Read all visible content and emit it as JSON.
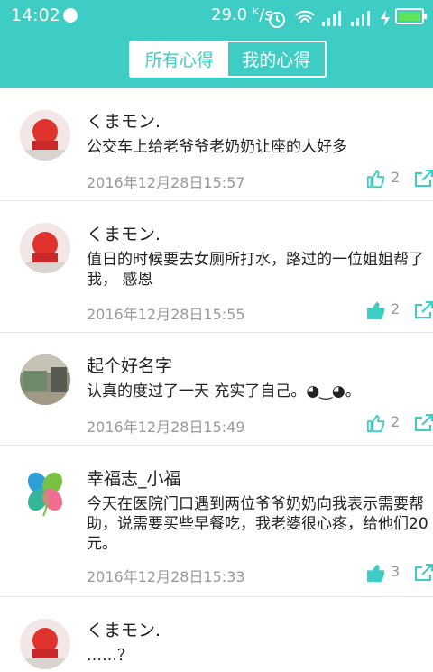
{
  "status_bar": {
    "time": "14:02",
    "speed": "29.0 ᴷ/s"
  },
  "tabs": [
    {
      "label": "所有心得",
      "active": true
    },
    {
      "label": "我的心得",
      "active": false
    }
  ],
  "posts": [
    {
      "name": "くまモン.",
      "content": "公交车上给老爷爷老奶奶让座的人好多",
      "time": "2016年12月28日15:57",
      "likes": "2",
      "liked": false,
      "avatar": "red-bear"
    },
    {
      "name": "くまモン.",
      "content": "值日的时候要去女厕所打水，路过的一位姐姐帮了我，  感恩",
      "time": "2016年12月28日15:55",
      "likes": "2",
      "liked": true,
      "avatar": "red-bear"
    },
    {
      "name": "起个好名字",
      "content": "认真的度过了一天 充实了自己。◕‿◕。",
      "time": "2016年12月28日15:49",
      "likes": "2",
      "liked": false,
      "avatar": "room-photo"
    },
    {
      "name": "幸福志_小福",
      "content": "今天在医院门口遇到两位爷爷奶奶向我表示需要帮助，说需要买些早餐吃，我老婆很心疼，给他们20元。",
      "time": "2016年12月28日15:33",
      "likes": "3",
      "liked": true,
      "avatar": "clover"
    },
    {
      "name": "くまモン.",
      "content": "……？",
      "time": "",
      "likes": "",
      "liked": false,
      "avatar": "red-bear"
    }
  ],
  "colors": {
    "accent": "#3ecdc4",
    "text": "#222222",
    "muted": "#9a9a9a"
  }
}
